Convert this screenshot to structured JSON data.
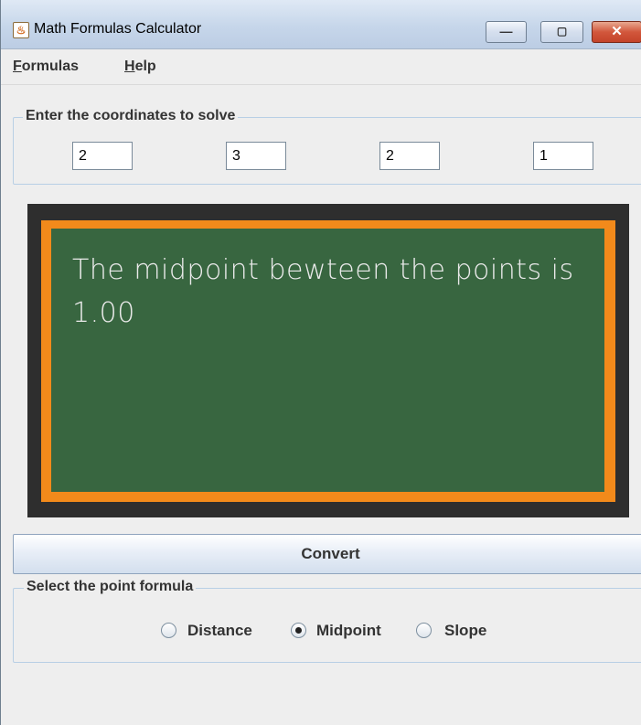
{
  "window": {
    "title": "Math Formulas Calculator",
    "controls": {
      "minimize": "—",
      "maximize": "▢",
      "close": "✕"
    }
  },
  "menubar": {
    "items": [
      {
        "mnemonic": "F",
        "rest": "ormulas"
      },
      {
        "mnemonic": "H",
        "rest": "elp"
      }
    ]
  },
  "coordinates": {
    "title": "Enter the coordinates to solve",
    "values": [
      "2",
      "3",
      "2",
      "1"
    ]
  },
  "board": {
    "line1": "The midpoint bewteen the points is",
    "line2": "1.00"
  },
  "convert_label": "Convert",
  "formula_group": {
    "title": "Select the point formula",
    "options": [
      {
        "label": "Distance",
        "selected": false
      },
      {
        "label": "Midpoint",
        "selected": true
      },
      {
        "label": "Slope",
        "selected": false
      }
    ]
  },
  "colors": {
    "board_outer": "#2e2e2e",
    "board_frame": "#f28a1b",
    "board_surface": "#386640",
    "chalk": "#eaeaea"
  }
}
